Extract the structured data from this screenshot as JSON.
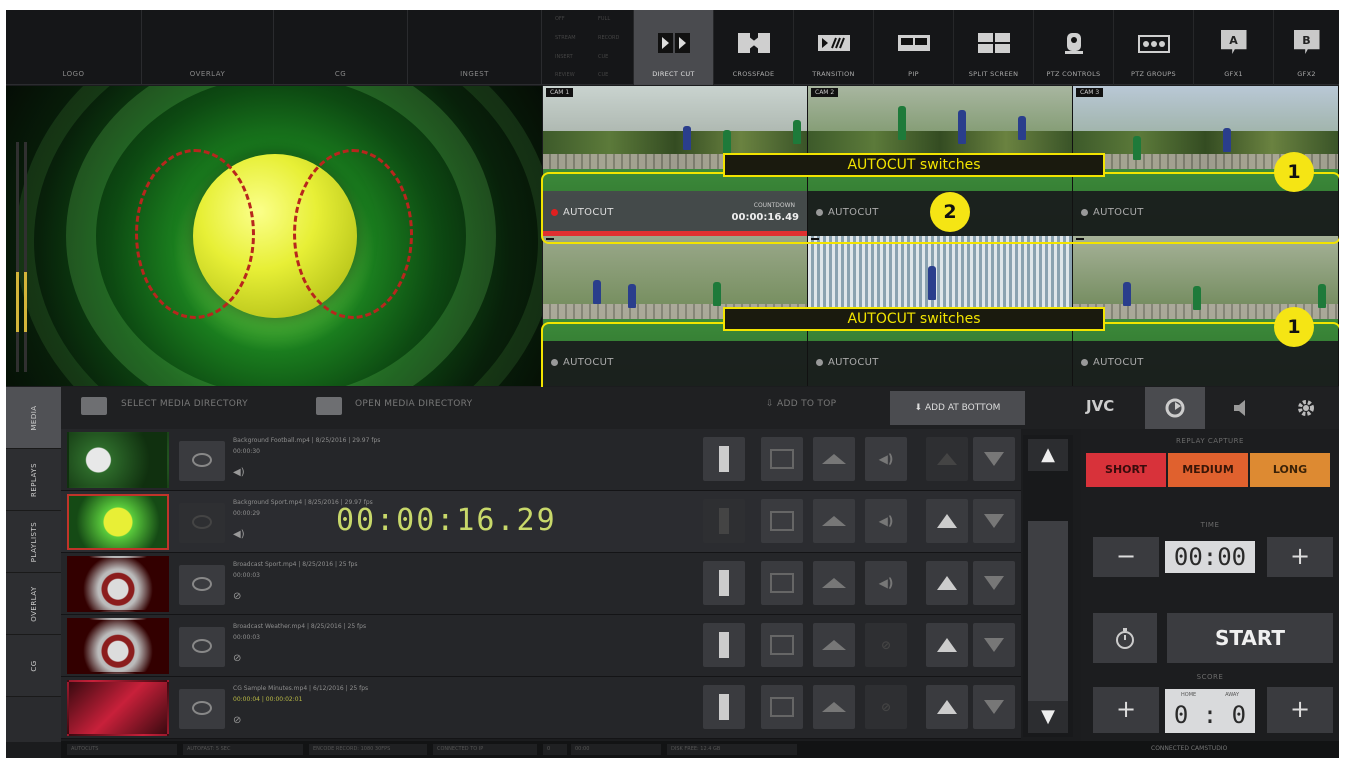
{
  "top_labels": [
    "LOGO",
    "OVERLAY",
    "CG",
    "INGEST"
  ],
  "mini_grid": [
    "OFF",
    "FULL",
    "STREAM",
    "RECORD",
    "INSERT",
    "CUE",
    "REVIEW",
    "CUE"
  ],
  "tools": [
    "DIRECT CUT",
    "CROSSFADE",
    "TRANSITION",
    "PIP",
    "SPLIT SCREEN",
    "PTZ CONTROLS",
    "PTZ GROUPS",
    "GFX1",
    "GFX2"
  ],
  "gfx_letters": [
    "A",
    "B"
  ],
  "cams": [
    {
      "tag": "CAM 1",
      "status": "AUTOCUT",
      "countdown_label": "COUNTDOWN",
      "countdown": "00:00:16.49"
    },
    {
      "tag": "CAM 2",
      "status": "AUTOCUT"
    },
    {
      "tag": "CAM 3",
      "status": "AUTOCUT"
    },
    {
      "tag": "",
      "status": "AUTOCUT"
    },
    {
      "tag": "",
      "status": "AUTOCUT"
    },
    {
      "tag": "",
      "status": "AUTOCUT"
    }
  ],
  "callouts": {
    "label_top": "AUTOCUT switches",
    "label_bottom": "AUTOCUT switches",
    "badge_1a": "1",
    "badge_2": "2",
    "badge_1b": "1"
  },
  "mediabar": {
    "select_dir": "SELECT MEDIA DIRECTORY",
    "open_dir": "OPEN MEDIA DIRECTORY",
    "add_top": "ADD TO TOP",
    "add_bottom": "ADD AT BOTTOM",
    "brand": "JVC"
  },
  "left_tabs": [
    "MEDIA",
    "REPLAYS",
    "PLAYLISTS",
    "OVERLAY",
    "CG"
  ],
  "media_rows": [
    {
      "title": "Background Football.mp4 | 8/25/2016 | 29.97 fps",
      "duration": "00:00:30"
    },
    {
      "title": "Background Sport.mp4 | 8/25/2016 | 29.97 fps",
      "duration": "00:00:29"
    },
    {
      "title": "Broadcast Sport.mp4 | 8/25/2016 | 25 fps",
      "duration": "00:00:03"
    },
    {
      "title": "Broadcast Weather.mp4 | 8/25/2016 | 25 fps",
      "duration": "00:00:03"
    },
    {
      "title": "CG Sample Minutes.mp4 | 6/12/2016 | 25 fps",
      "duration": "00:00:04 | 00:00:02:01"
    }
  ],
  "playing_timecode": "00:00:16.29",
  "replay": {
    "capture_label": "REPLAY CAPTURE",
    "short": "SHORT",
    "medium": "MEDIUM",
    "long": "LONG",
    "time_label": "TIME",
    "time": "00:00",
    "minus": "−",
    "plus": "+",
    "start": "START",
    "score_label": "SCORE",
    "home": "HOME",
    "away": "AWAY",
    "score": "0 : 0"
  },
  "status": {
    "items": [
      "AUTOCUTS",
      "AUTOFAST: 5 SEC",
      "ENCODE RECORD: 1080 30FPS",
      "CONNECTED TO IP",
      "0",
      "00:00",
      "DISK FREE: 12.4 GB"
    ],
    "connected": "CONNECTED CAMSTUDIO"
  },
  "colors": {
    "accent": "#f2e400",
    "live": "#e03030",
    "short": "#d8323a",
    "medium": "#e0612e",
    "long": "#dd8a32"
  }
}
